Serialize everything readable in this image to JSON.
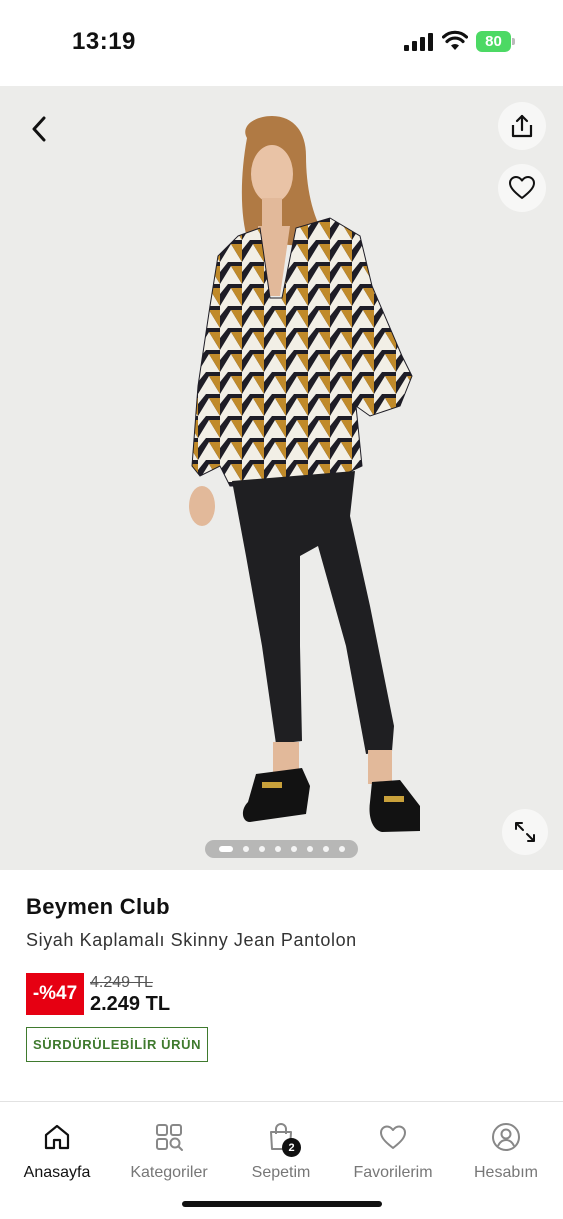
{
  "status_bar": {
    "time": "13:19",
    "battery": "80",
    "icons": [
      "signal-icon",
      "wifi-icon",
      "battery-icon"
    ]
  },
  "gallery": {
    "image_count": 8,
    "active_index": 0,
    "icons": {
      "back": "chevron-left-icon",
      "share": "share-icon",
      "favorite": "heart-icon",
      "fullscreen": "expand-icon"
    }
  },
  "product": {
    "brand": "Beymen Club",
    "name": "Siyah Kaplamalı Skinny Jean Pantolon",
    "discount": "-%47",
    "old_price": "4.249 TL",
    "price": "2.249 TL",
    "tag": "SÜRDÜRÜLEBİLİR ÜRÜN"
  },
  "tab_bar": {
    "items": [
      {
        "label": "Anasayfa",
        "icon": "home-icon",
        "active": true
      },
      {
        "label": "Kategoriler",
        "icon": "categories-icon",
        "active": false
      },
      {
        "label": "Sepetim",
        "icon": "shopping-bag-icon",
        "active": false,
        "badge": "2"
      },
      {
        "label": "Favorilerim",
        "icon": "heart-icon",
        "active": false
      },
      {
        "label": "Hesabım",
        "icon": "user-icon",
        "active": false
      }
    ]
  },
  "colors": {
    "discount": "#e60012",
    "sustainable": "#3f7a2e",
    "battery": "#4cd964"
  }
}
